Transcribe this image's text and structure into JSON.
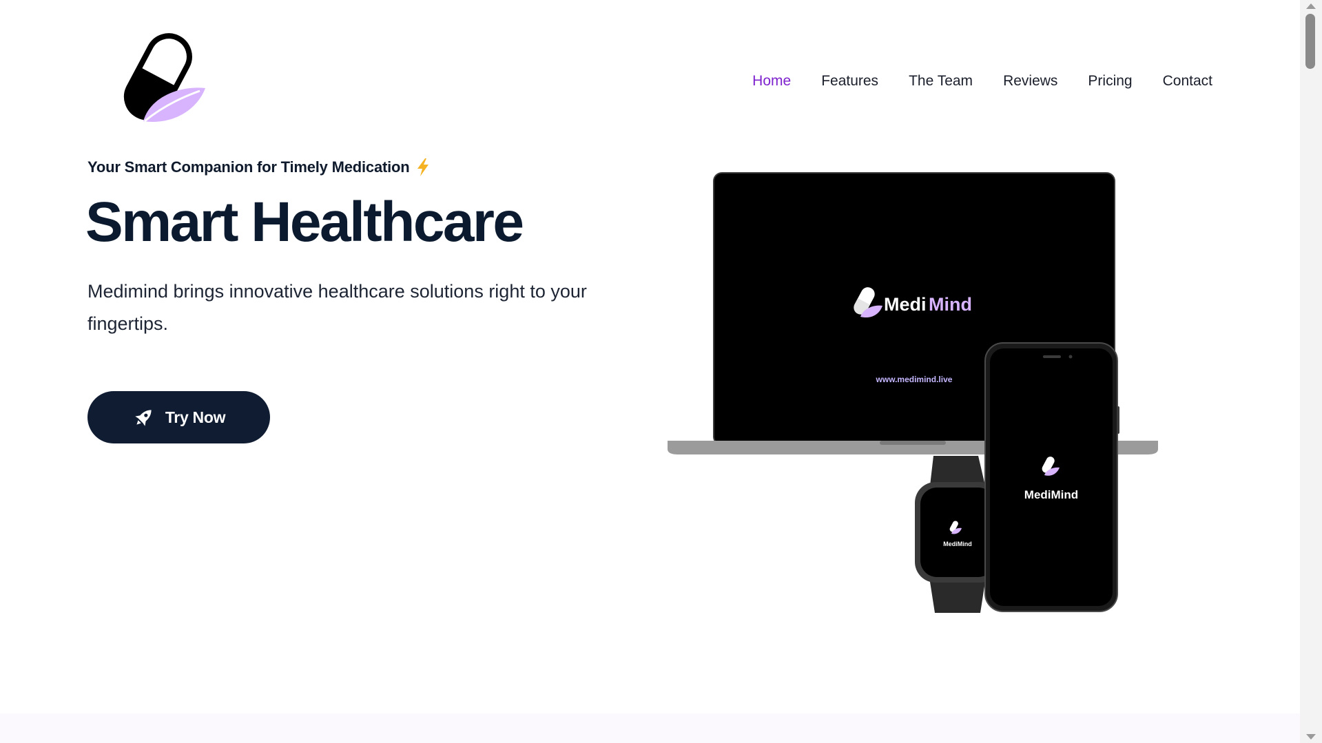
{
  "colors": {
    "accent": "#7e22ce",
    "navy": "#0f1c32",
    "logo_leaf": "#d8b4fe",
    "device_black": "#000000"
  },
  "nav": {
    "items": [
      {
        "label": "Home",
        "active": true
      },
      {
        "label": "Features",
        "active": false
      },
      {
        "label": "The Team",
        "active": false
      },
      {
        "label": "Reviews",
        "active": false
      },
      {
        "label": "Pricing",
        "active": false
      },
      {
        "label": "Contact",
        "active": false
      }
    ]
  },
  "hero": {
    "tagline": "Your Smart Companion for Timely Medication",
    "tagline_icon": "lightning-bolt-icon",
    "headline": "Smart Healthcare",
    "lede": "Medimind brings innovative healthcare solutions right to your fingertips.",
    "cta_label": "Try Now",
    "cta_icon": "rocket-icon"
  },
  "devices": {
    "brand_prefix": "Medi",
    "brand_suffix": "Mind",
    "laptop_url": "www.medimind.live"
  }
}
